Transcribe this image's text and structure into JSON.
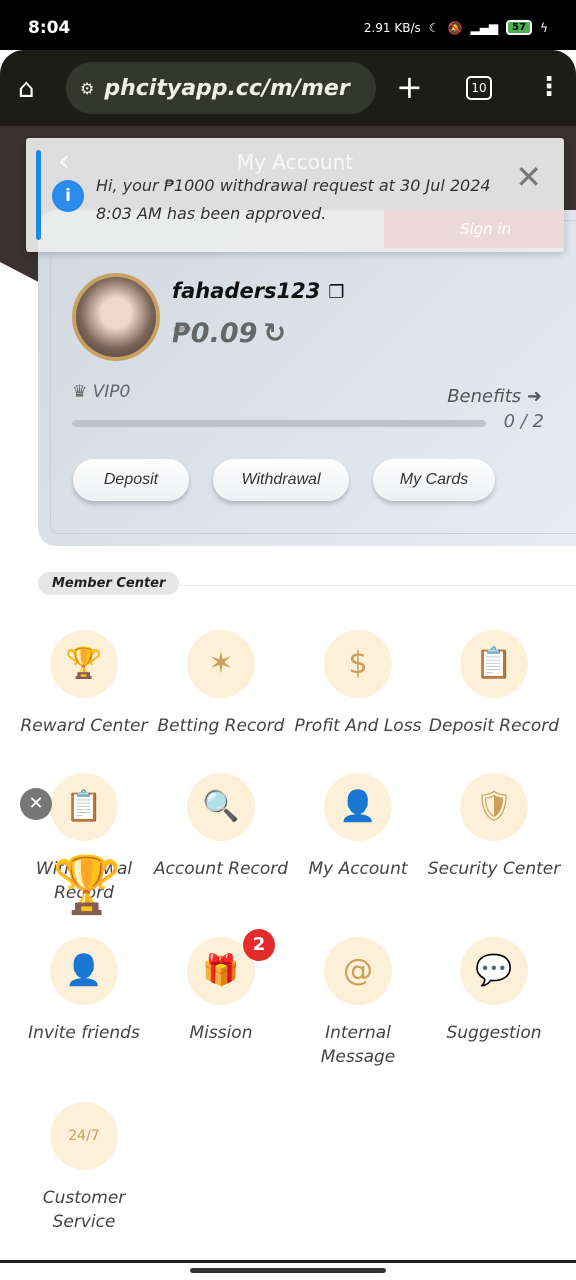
{
  "status_bar": {
    "time": "8:04",
    "speed": "2.91 KB/s",
    "battery": "57"
  },
  "browser": {
    "url": "phcityapp.cc/m/mer",
    "tab_count": "10"
  },
  "header": {
    "title": "My Account",
    "sign_in": "Sign in"
  },
  "toast": {
    "message": "Hi, your ₱1000 withdrawal request at 30 Jul 2024 8:03 AM has been approved."
  },
  "account": {
    "username": "fahaders123",
    "balance": "₱0.09",
    "vip_level": "VIP0",
    "benefits_label": "Benefits",
    "progress": "0 / 2",
    "progress_fraction": 0,
    "buttons": {
      "deposit": "Deposit",
      "withdrawal": "Withdrawal",
      "cards": "My Cards"
    }
  },
  "member_center": {
    "title": "Member Center",
    "items": [
      {
        "label": "Reward Center",
        "icon": "trophy-icon"
      },
      {
        "label": "Betting Record",
        "icon": "sparkle-icon"
      },
      {
        "label": "Profit And Loss",
        "icon": "receipt-icon"
      },
      {
        "label": "Deposit Record",
        "icon": "clipboard-upload-icon"
      },
      {
        "label": "Withdrawal Record",
        "icon": "clipboard-download-icon"
      },
      {
        "label": "Account Record",
        "icon": "chart-search-icon"
      },
      {
        "label": "My Account",
        "icon": "user-icon"
      },
      {
        "label": "Security Center",
        "icon": "shield-user-icon"
      },
      {
        "label": "Invite friends",
        "icon": "add-user-icon"
      },
      {
        "label": "Mission",
        "icon": "gift-icon",
        "badge": "2"
      },
      {
        "label": "Internal Message",
        "icon": "at-icon"
      },
      {
        "label": "Suggestion",
        "icon": "chat-star-icon"
      },
      {
        "label": "Customer Service",
        "icon": "24-7-icon"
      }
    ]
  },
  "colors": {
    "accent_gold": "#c9a05a",
    "icon_bg": "#fdf0d8",
    "toast_bar": "#1e88e5",
    "badge": "#e52b2b"
  }
}
